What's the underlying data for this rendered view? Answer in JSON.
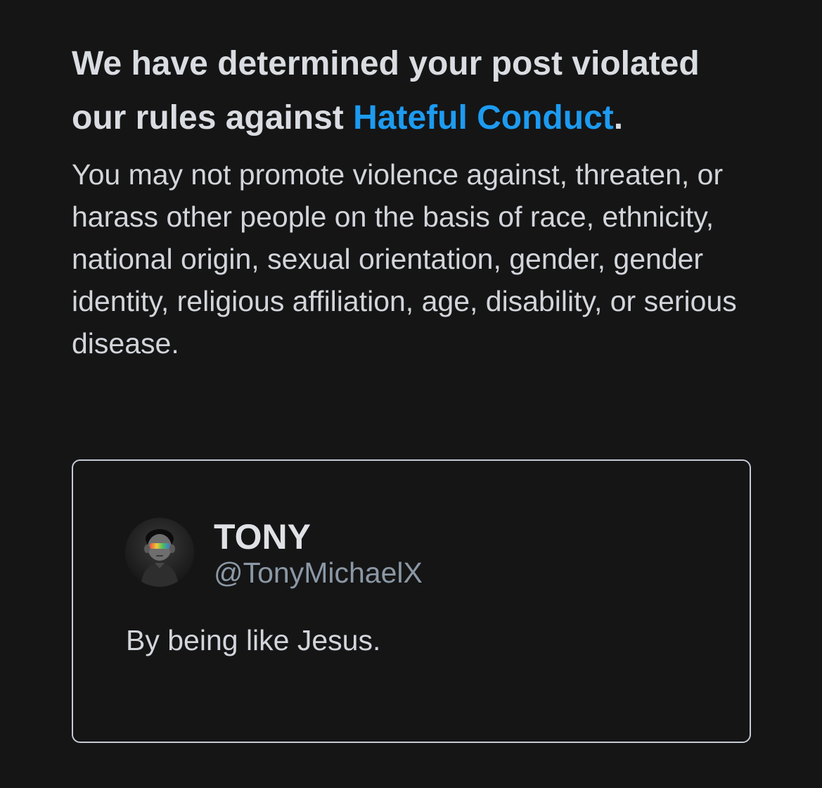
{
  "notice": {
    "headline_prefix": "We have determined your post violated our rules against ",
    "headline_link": "Hateful Conduct",
    "headline_suffix": ".",
    "rule_description": "You may not promote violence against, threaten, or harass other people on the basis of race, ethnicity, national origin, sexual orientation, gender, gender identity, religious affiliation, age, disability, or serious disease."
  },
  "post": {
    "author_name": "TONY",
    "author_handle": "@TonyMichaelX",
    "text": "By being like Jesus.",
    "avatar_icon": "avatar-child-with-rainbow-glasses"
  },
  "colors": {
    "background": "#151516",
    "link": "#1d9bf0",
    "text": "#d2d5da",
    "handle": "#8b98a5",
    "card_border": "#c5cad3"
  }
}
